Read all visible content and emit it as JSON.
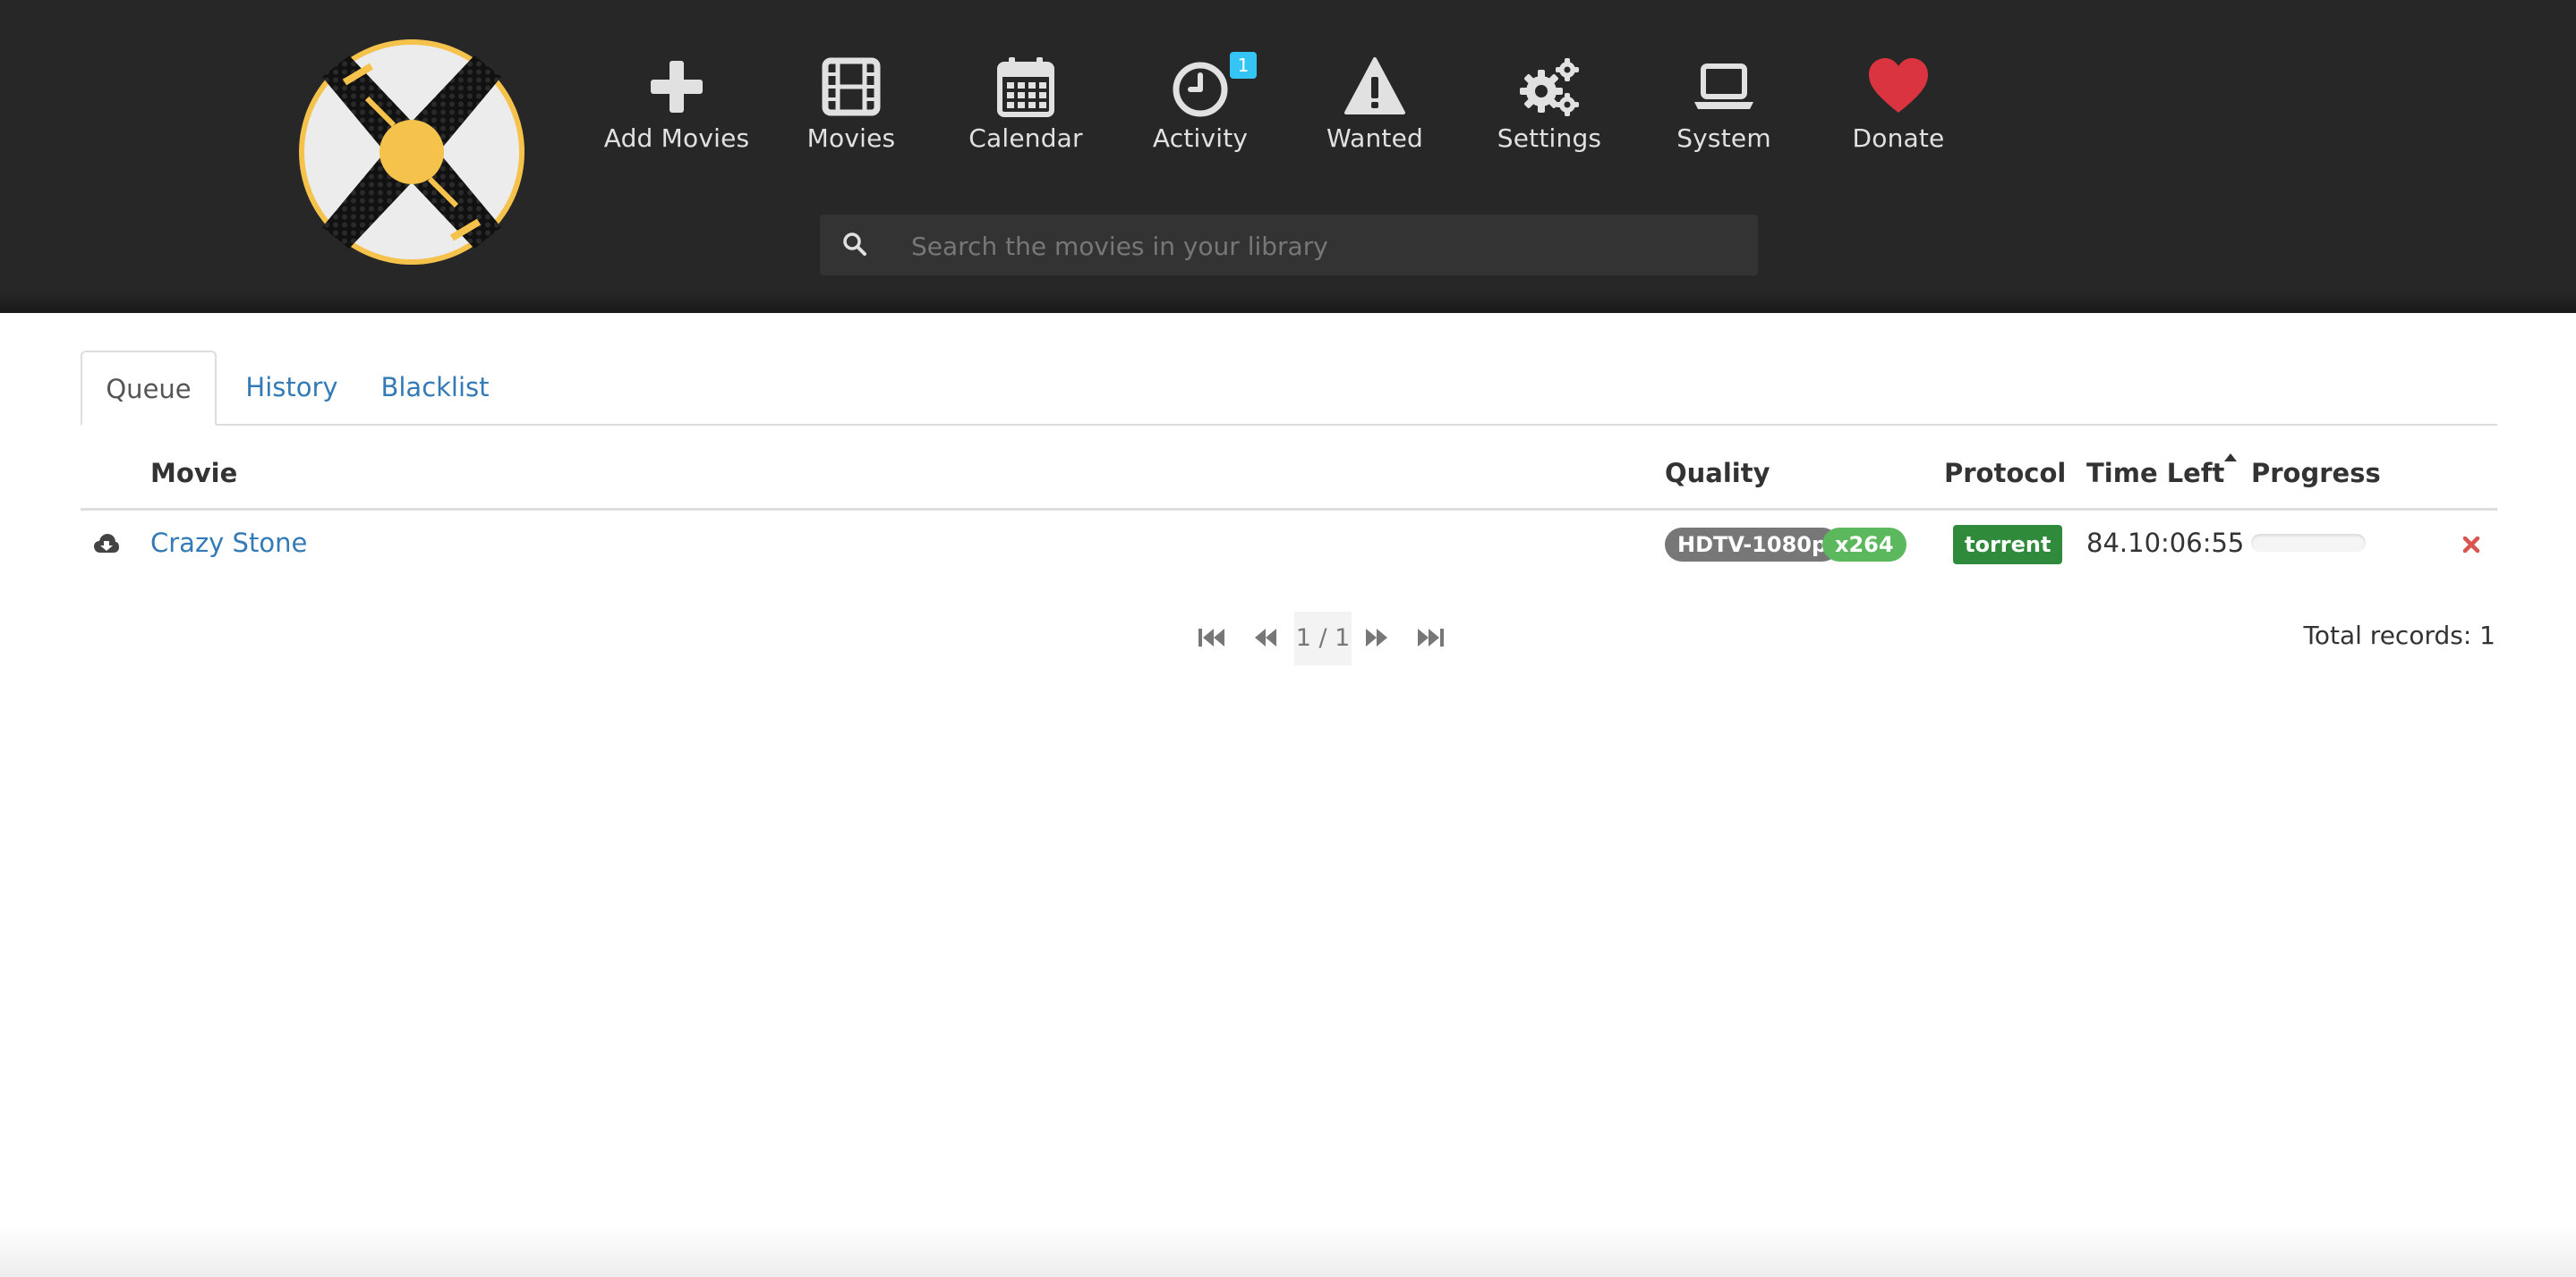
{
  "header": {
    "nav": [
      {
        "label": "Add Movies",
        "icon": "plus-icon"
      },
      {
        "label": "Movies",
        "icon": "film-icon"
      },
      {
        "label": "Calendar",
        "icon": "calendar-icon"
      },
      {
        "label": "Activity",
        "icon": "clock-icon",
        "badge": "1"
      },
      {
        "label": "Wanted",
        "icon": "warning-icon"
      },
      {
        "label": "Settings",
        "icon": "gears-icon"
      },
      {
        "label": "System",
        "icon": "laptop-icon"
      },
      {
        "label": "Donate",
        "icon": "heart-icon",
        "color": "#d9343f"
      }
    ],
    "search": {
      "placeholder": "Search the movies in your library",
      "value": ""
    }
  },
  "tabs": [
    {
      "label": "Queue",
      "active": true
    },
    {
      "label": "History",
      "active": false
    },
    {
      "label": "Blacklist",
      "active": false
    }
  ],
  "queue": {
    "columns": {
      "movie": "Movie",
      "quality": "Quality",
      "protocol": "Protocol",
      "time_left": "Time Left",
      "progress": "Progress"
    },
    "sort_column": "Time Left",
    "sort_direction": "ascending",
    "rows": [
      {
        "status_icon": "cloud-download-icon",
        "movie": "Crazy Stone",
        "quality": "HDTV-1080p",
        "codec": "x264",
        "protocol": "torrent",
        "time_left": "84.10:06:55",
        "progress": 0
      }
    ]
  },
  "pager": {
    "page_text": "1 / 1"
  },
  "total_records": "Total records: 1",
  "colors": {
    "header_bg": "#272727",
    "link": "#337ab7",
    "quality_badge": "#777777",
    "codec_badge": "#5cb85c",
    "protocol_badge": "#2f8a3c",
    "activity_badge": "#35c5f4",
    "remove": "#d9534f",
    "logo_accent": "#f5c24c"
  }
}
